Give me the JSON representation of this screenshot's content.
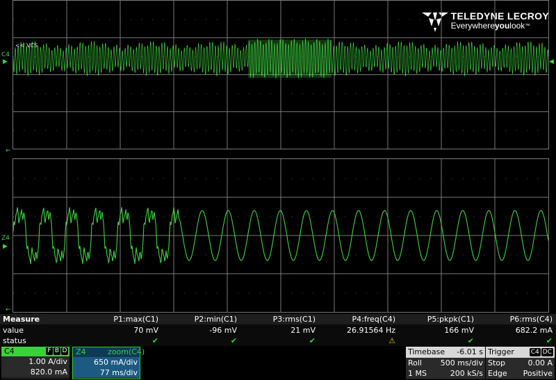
{
  "logo": {
    "brand": "TELEDYNE LECROY",
    "tag_pre": "Everywhere",
    "tag_bold": "you",
    "tag_post": "look",
    "tm": "™"
  },
  "grid1": {
    "channel_label": "C4",
    "trace_label": "<< VCS",
    "color": "#3fd43f"
  },
  "grid2": {
    "channel_label": "Z4",
    "color": "#3fd43f"
  },
  "measure": {
    "title": "Measure",
    "row_value_label": "value",
    "row_status_label": "status",
    "params": [
      {
        "name": "P1:max(C1)",
        "value": "70 mV",
        "status": "ok"
      },
      {
        "name": "P2:min(C1)",
        "value": "-96 mV",
        "status": "ok"
      },
      {
        "name": "P3:rms(C1)",
        "value": "21 mV",
        "status": "ok"
      },
      {
        "name": "P4:freq(C4)",
        "value": "26.91564 Hz",
        "status": "warn"
      },
      {
        "name": "P5:pkpk(C1)",
        "value": "166 mV",
        "status": "ok"
      },
      {
        "name": "P6:rms(C4)",
        "value": "682.2 mA",
        "status": "ok"
      }
    ],
    "ok_glyph": "✔",
    "warn_glyph": "⚠"
  },
  "c4": {
    "name": "C4",
    "flags": [
      "F",
      "B",
      "D"
    ],
    "scale": "1.00 A/div",
    "offset": "820.0 mA"
  },
  "z4": {
    "name": "Z4",
    "desc": "zoom(C4)",
    "scale": "650 mA/div",
    "time": "77 ms/div"
  },
  "timebase": {
    "label": "Timebase",
    "delay": "-6.01 s",
    "mode": "Roll",
    "tdiv": "500 ms/div",
    "mem": "1 MS",
    "rate": "200 kS/s"
  },
  "trigger": {
    "label": "Trigger",
    "flags": [
      "C4",
      "DC"
    ],
    "state": "Stop",
    "level": "0.00 A",
    "type": "Edge",
    "slope": "Positive"
  },
  "colors": {
    "trace": "#3fd43f",
    "grid": "#7a7a7a",
    "accent": "#3ad23a",
    "zoom_bg": "#1d5a82"
  }
}
